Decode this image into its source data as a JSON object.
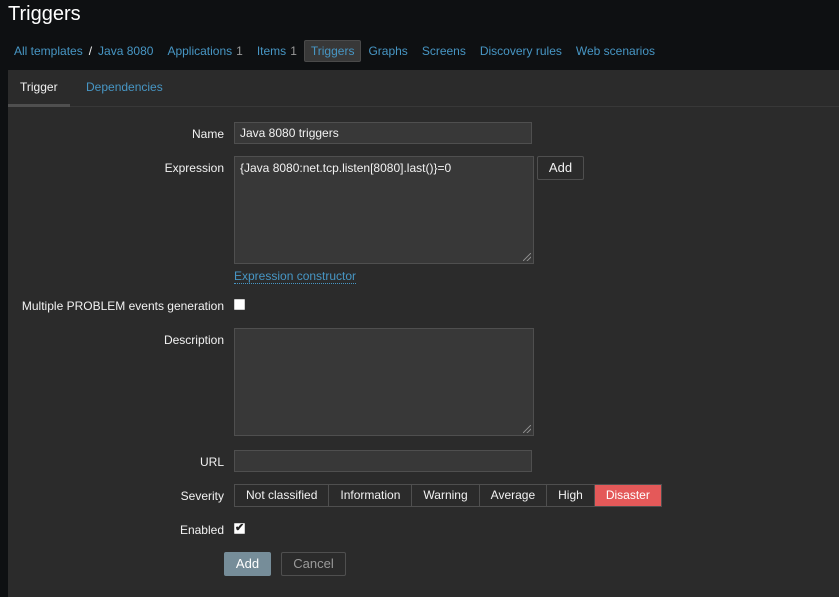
{
  "page_title": "Triggers",
  "nav": {
    "all_templates": "All templates",
    "separator": "/",
    "template_name": "Java 8080",
    "applications": {
      "label": "Applications",
      "count": "1"
    },
    "items": {
      "label": "Items",
      "count": "1"
    },
    "triggers": "Triggers",
    "graphs": "Graphs",
    "screens": "Screens",
    "discovery_rules": "Discovery rules",
    "web_scenarios": "Web scenarios"
  },
  "tabs": {
    "trigger": "Trigger",
    "dependencies": "Dependencies"
  },
  "form": {
    "name_label": "Name",
    "name_value": "Java 8080 triggers",
    "expression_label": "Expression",
    "expression_value": "{Java 8080:net.tcp.listen[8080].last()}=0",
    "expression_add": "Add",
    "expression_constructor": "Expression constructor",
    "multiple_label": "Multiple PROBLEM events generation",
    "multiple_checked": false,
    "description_label": "Description",
    "description_value": "",
    "url_label": "URL",
    "url_value": "",
    "severity_label": "Severity",
    "severity_options": [
      "Not classified",
      "Information",
      "Warning",
      "Average",
      "High",
      "Disaster"
    ],
    "severity_selected": "Disaster",
    "enabled_label": "Enabled",
    "enabled_checked": true,
    "enabled_mark": "✔",
    "add_button": "Add",
    "cancel_button": "Cancel"
  },
  "colors": {
    "background": "#0e1012",
    "panel": "#2b2b2b",
    "link": "#4796c4",
    "disaster": "#e45959",
    "primary_button": "#768d99"
  }
}
